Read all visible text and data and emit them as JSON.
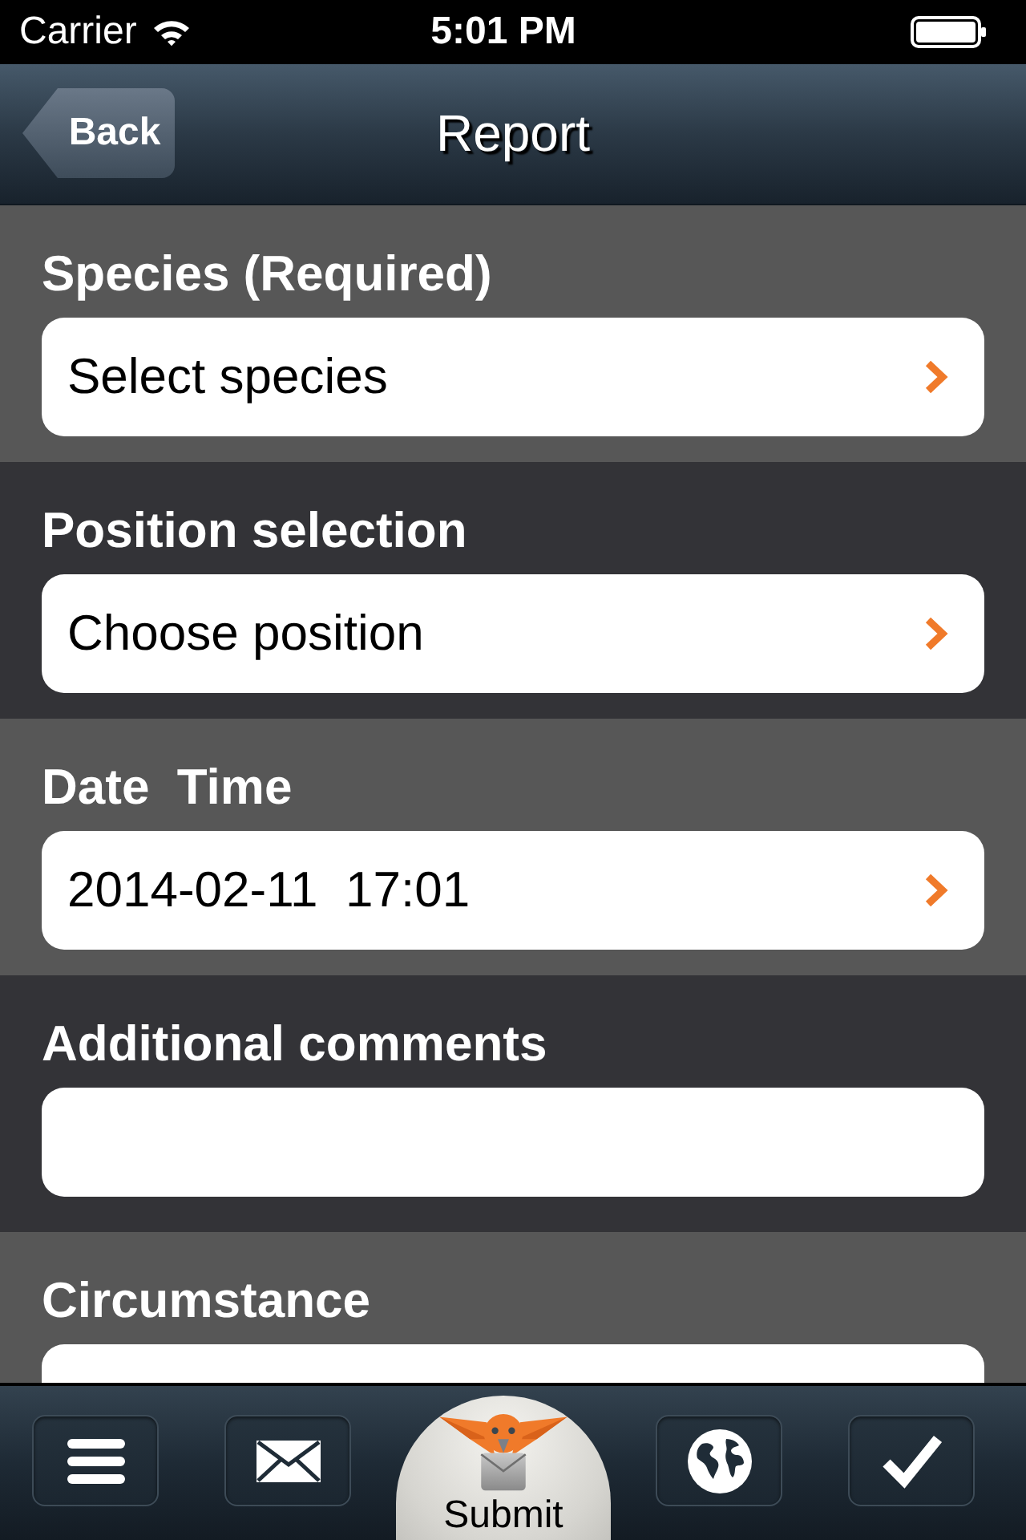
{
  "status_bar": {
    "carrier": "Carrier",
    "time": "5:01 PM"
  },
  "nav_bar": {
    "back": "Back",
    "title": "Report"
  },
  "sections": [
    {
      "label": "Species (Required)",
      "field": {
        "kind": "picker",
        "text": "Select species"
      }
    },
    {
      "label": "Position selection",
      "field": {
        "kind": "picker",
        "text": "Choose position"
      }
    },
    {
      "label": "Date  Time",
      "field": {
        "kind": "picker",
        "text": "2014-02-11  17:01"
      }
    },
    {
      "label": "Additional comments",
      "field": {
        "kind": "input"
      }
    },
    {
      "label": "Circumstance",
      "field": {
        "kind": "input"
      }
    }
  ],
  "tab_bar": {
    "submit": "Submit"
  }
}
